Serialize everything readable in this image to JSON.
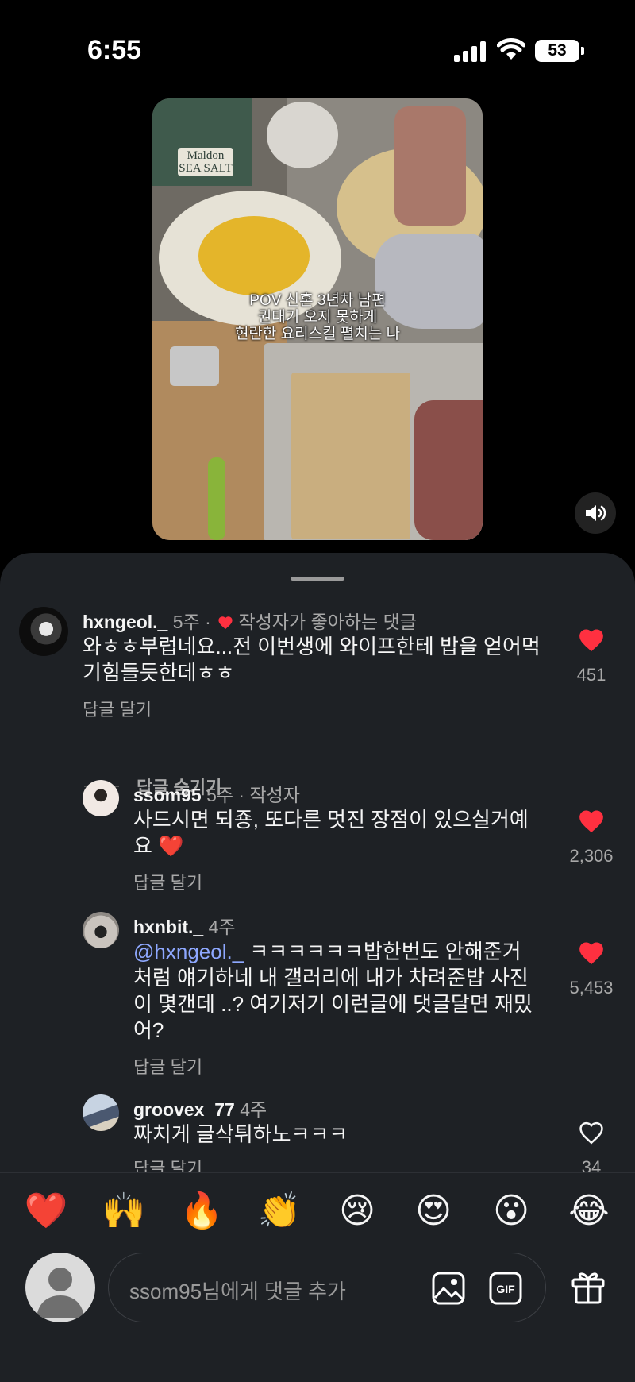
{
  "status_bar": {
    "time": "6:55",
    "battery": "53"
  },
  "video": {
    "caption": "POV 신혼 3년차 남편\n권태기 오지 못하게\n현란한 요리스킬 펼치는 나",
    "box_label": "Maldon\nSEA SALT"
  },
  "comments": [
    {
      "username": "hxngeol._",
      "meta": "5주 ·",
      "creator_liked": "작성자가 좋아하는 댓글",
      "text_line1": "와ㅎㅎ부럽네요...전 이번생에 와이프한테 밥을 얻어먹",
      "text_line2": "기힘들듯한데ㅎㅎ",
      "reply": "답글 달기",
      "likes": "451",
      "liked": true
    },
    {
      "username": "ssom95",
      "meta": "5주 · 작성자",
      "text_line1": "사드시면 되죵, 또다른 멋진 장점이 있으실거예",
      "text_line2": "요 ❤️",
      "reply": "답글 달기",
      "likes": "2,306",
      "liked": true
    },
    {
      "username": "hxnbit._",
      "meta": "4주",
      "mention": "@hxngeol._",
      "text_line1": " ㅋㅋㅋㅋㅋㅋ밥한번도 안해준거",
      "text_line2": "처럼 얘기하네 내 갤러리에 내가 차려준밥 사진",
      "text_line3": "이 몇갠데 ..? 여기저기 이런글에 댓글달면 재밌",
      "text_line4": "어?",
      "reply": "답글 달기",
      "likes": "5,453",
      "liked": true
    },
    {
      "username": "groovex_77",
      "meta": "4주",
      "text_line1": "짜치게 글삭튀하노ㅋㅋㅋ",
      "reply": "답글 달기",
      "likes": "34",
      "liked": false
    }
  ],
  "hide_replies": "답글 숨기기",
  "emojis": [
    "❤️",
    "🙌",
    "🔥",
    "👏",
    "😢",
    "😍",
    "😮",
    "😂"
  ],
  "input": {
    "placeholder": "ssom95님에게 댓글 추가"
  },
  "colors": {
    "like_red": "#ff3040",
    "sheet_bg": "#1e2125",
    "mention_blue": "#8ea8ff"
  }
}
